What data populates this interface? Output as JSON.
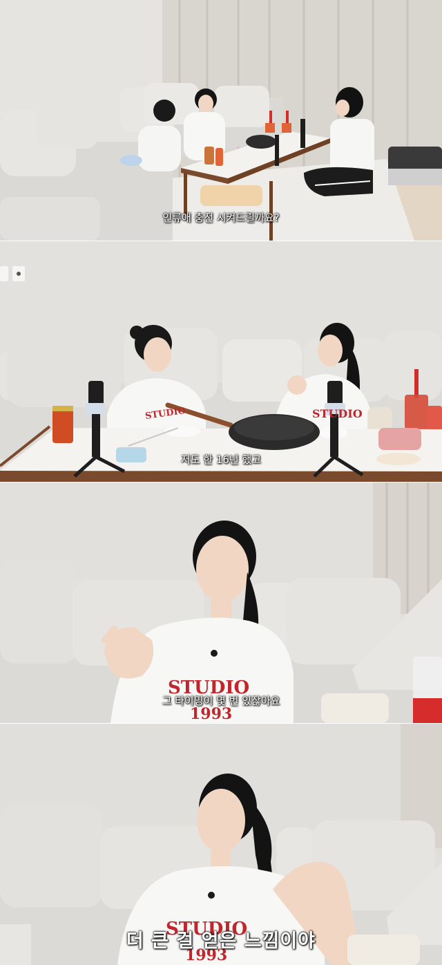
{
  "frames": [
    {
      "subtitle": "인류애 충전 시켜드릴까요?"
    },
    {
      "subtitle": "저도 한 16년 했고",
      "can_label": "",
      "shirt_text": "STUDIO"
    },
    {
      "subtitle": "그 타이밍이 몇 번 있잖아요",
      "shirt_text": "STUDIO",
      "shirt_year": "1993"
    },
    {
      "subtitle": "더 큰 걸 얻은 느낌이야",
      "shirt_text": "STUDIO",
      "shirt_year": "1993"
    }
  ],
  "colors": {
    "wall": "#e4e2df",
    "sofa": "#dcdad6",
    "cushion": "#e7e5e1",
    "table_top": "#f4f2ef",
    "table_edge": "#7b4a2c",
    "pan": "#2b2b2b",
    "shirt_print": "#c0262c",
    "hair": "#141414",
    "skin": "#f1d6c3"
  }
}
